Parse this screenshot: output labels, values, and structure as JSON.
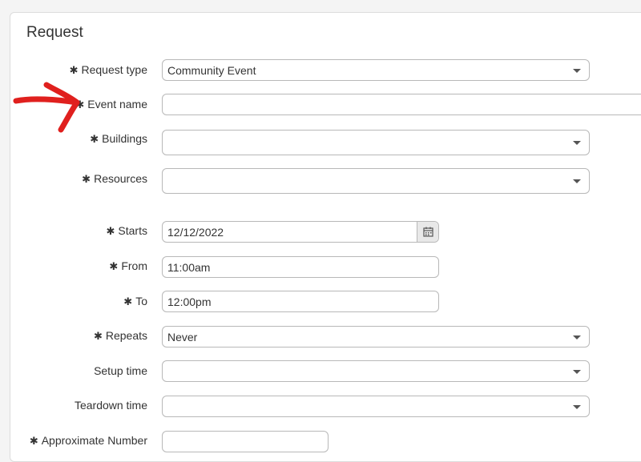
{
  "form": {
    "title": "Request",
    "required_marker": "✱",
    "fields": {
      "request_type": {
        "label": "Request type",
        "value": "Community Event"
      },
      "event_name": {
        "label": "Event name",
        "value": ""
      },
      "buildings": {
        "label": "Buildings",
        "value": ""
      },
      "resources": {
        "label": "Resources",
        "value": ""
      },
      "starts": {
        "label": "Starts",
        "value": "12/12/2022"
      },
      "from": {
        "label": "From",
        "value": "11:00am"
      },
      "to": {
        "label": "To",
        "value": "12:00pm"
      },
      "repeats": {
        "label": "Repeats",
        "value": "Never"
      },
      "setup_time": {
        "label": "Setup time",
        "value": ""
      },
      "teardown_time": {
        "label": "Teardown time",
        "value": ""
      },
      "attendees": {
        "label": "Approximate Number",
        "value": ""
      }
    }
  },
  "annotation": {
    "color": "#e0201e",
    "icon": "red-arrow-icon"
  }
}
